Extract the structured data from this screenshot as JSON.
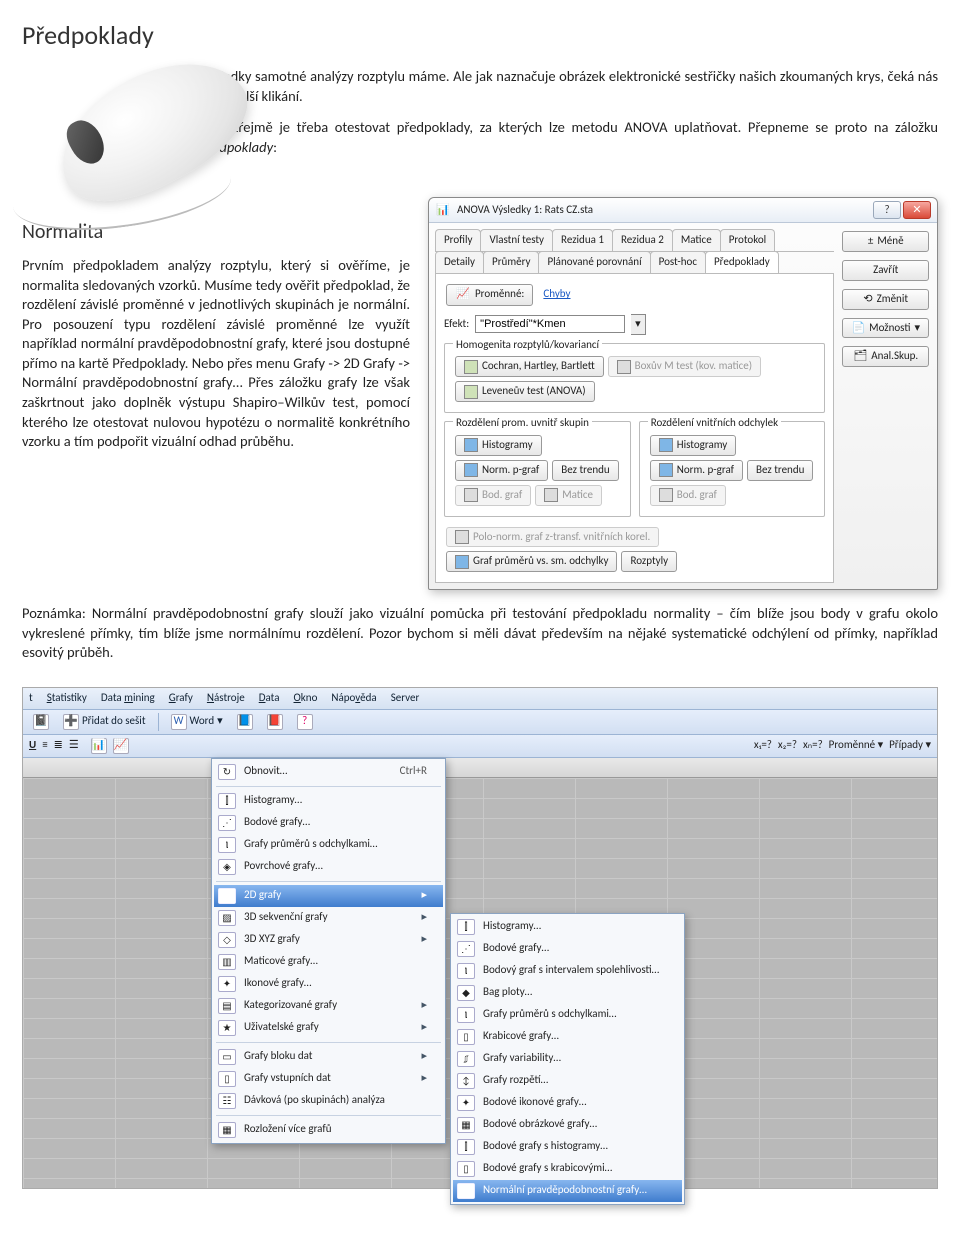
{
  "headings": {
    "h1": "Předpoklady",
    "h2": "Normalita"
  },
  "intro": {
    "p1": "Výsledky samotné analýzy rozptylu máme. Ale jak naznačuje obrázek elektronické sestřičky našich zkoumaných krys, čeká nás ještě další klikání.",
    "p2a": "Samozřejmě je třeba otestovat předpoklady, za kterých lze metodu ANOVA uplatňovat. Přepneme se proto na záložku ",
    "p2b": "Předpoklady",
    "p2c": ":"
  },
  "normalita": {
    "text": "Prvním předpokladem analýzy rozptylu, který si ověříme, je normalita sledovaných vzorků. Musíme tedy ověřit předpoklad, že rozdělení závislé proměnné v jednotlivých skupinách je normální. Pro posouzení typu rozdělení závislé proměnné lze využít například normální pravděpodobnostní grafy, které jsou dostupné přímo na kartě Předpoklady. Nebo přes menu Grafy -> 2D Grafy -> Normální pravděpodobnostní grafy… Přes záložku grafy lze však zaškrtnout jako doplněk výstupu Shapiro–Wilkův test, pomocí kterého lze otestovat nulovou hypotézu o normalitě konkrétního vzorku a tím podpořit vizuální odhad průběhu."
  },
  "note": {
    "label": "Poznámka:",
    "text": "Normální pravděpodobnostní grafy slouží jako vizuální pomůcka při testování předpokladu normality – čím blíže jsou body v grafu okolo vykreslené přímky, tím blíže jsme normálnímu rozdělení. Pozor bychom si měli dávat především na nějaké systematické odchýlení od přímky, například esovitý průběh."
  },
  "dialog": {
    "title": "ANOVA Výsledky 1: Rats CZ.sta",
    "tabs_row1": [
      "Profily",
      "Vlastní testy",
      "Rezidua 1",
      "Rezidua 2",
      "Matice",
      "Protokol"
    ],
    "tabs_row2": [
      "Detaily",
      "Průměry",
      "Plánované porovnání",
      "Post-hoc",
      "Předpoklady"
    ],
    "promenne_btn": "Proměnné:",
    "promenne_val": "Chyby",
    "efekt_label": "Efekt:",
    "efekt_val": "\"Prostředí\"*Kmen",
    "group_homog": "Homogenita rozptylů/kovariancí",
    "btn_cochran": "Cochran, Hartley, Bartlett",
    "btn_boxm": "Boxův M test (kov. matice)",
    "btn_levene": "Leveneův test (ANOVA)",
    "group_prom": "Rozdělení prom. uvnitř skupin",
    "group_odch": "Rozdělení vnitřních odchylek",
    "btn_hist": "Histogramy",
    "btn_norm": "Norm. p-graf",
    "btn_beztr": "Bez trendu",
    "btn_bod": "Bod. graf",
    "btn_matice": "Matice",
    "polo_label": "Polo-norm. graf z-transf. vnitřních korel.",
    "btn_grafprum": "Graf průměrů vs. sm. odchylky",
    "btn_rozptyly": "Rozptyly",
    "side": {
      "mene": "Méně",
      "zavrit": "Zavřít",
      "zmenit": "Změnit",
      "moznosti": "Možnosti",
      "analskup": "Anal.Skup."
    }
  },
  "menubar": {
    "items": [
      "t",
      "Statistiky",
      "Data mining",
      "Grafy",
      "Nástroje",
      "Data",
      "Okno",
      "Nápověda",
      "Server"
    ],
    "tool_pridat": "Přidat do sešit",
    "tool_word": "Word",
    "tool_promenne": "Proměnné",
    "tool_pripady": "Případy"
  },
  "menu1": {
    "obnovit": "Obnovit…",
    "obnovit_kbd": "Ctrl+R",
    "items_a": [
      "Histogramy…",
      "Bodové grafy…",
      "Grafy průměrů s odchylkami…",
      "Povrchové grafy…"
    ],
    "items_b": [
      "2D grafy",
      "3D sekvenční grafy",
      "3D XYZ grafy",
      "Maticové grafy…",
      "Ikonové grafy…",
      "Kategorizované grafy",
      "Uživatelské grafy"
    ],
    "items_c": [
      "Grafy bloku dat",
      "Grafy vstupních dat",
      "Dávková (po skupinách) analýza"
    ],
    "items_d": [
      "Rozložení více grafů"
    ]
  },
  "menu2": {
    "items": [
      "Histogramy…",
      "Bodové grafy…",
      "Bodový graf s intervalem spolehlivosti…",
      "Bag ploty…",
      "Grafy průměrů s odchylkami…",
      "Krabicové grafy…",
      "Grafy variability…",
      "Grafy rozpětí…",
      "Bodové ikonové grafy…",
      "Bodové obrázkové grafy…",
      "Bodové grafy s histogramy…",
      "Bodové grafy s krabicovými…",
      "Normální pravděpodobnostní grafy…"
    ]
  }
}
